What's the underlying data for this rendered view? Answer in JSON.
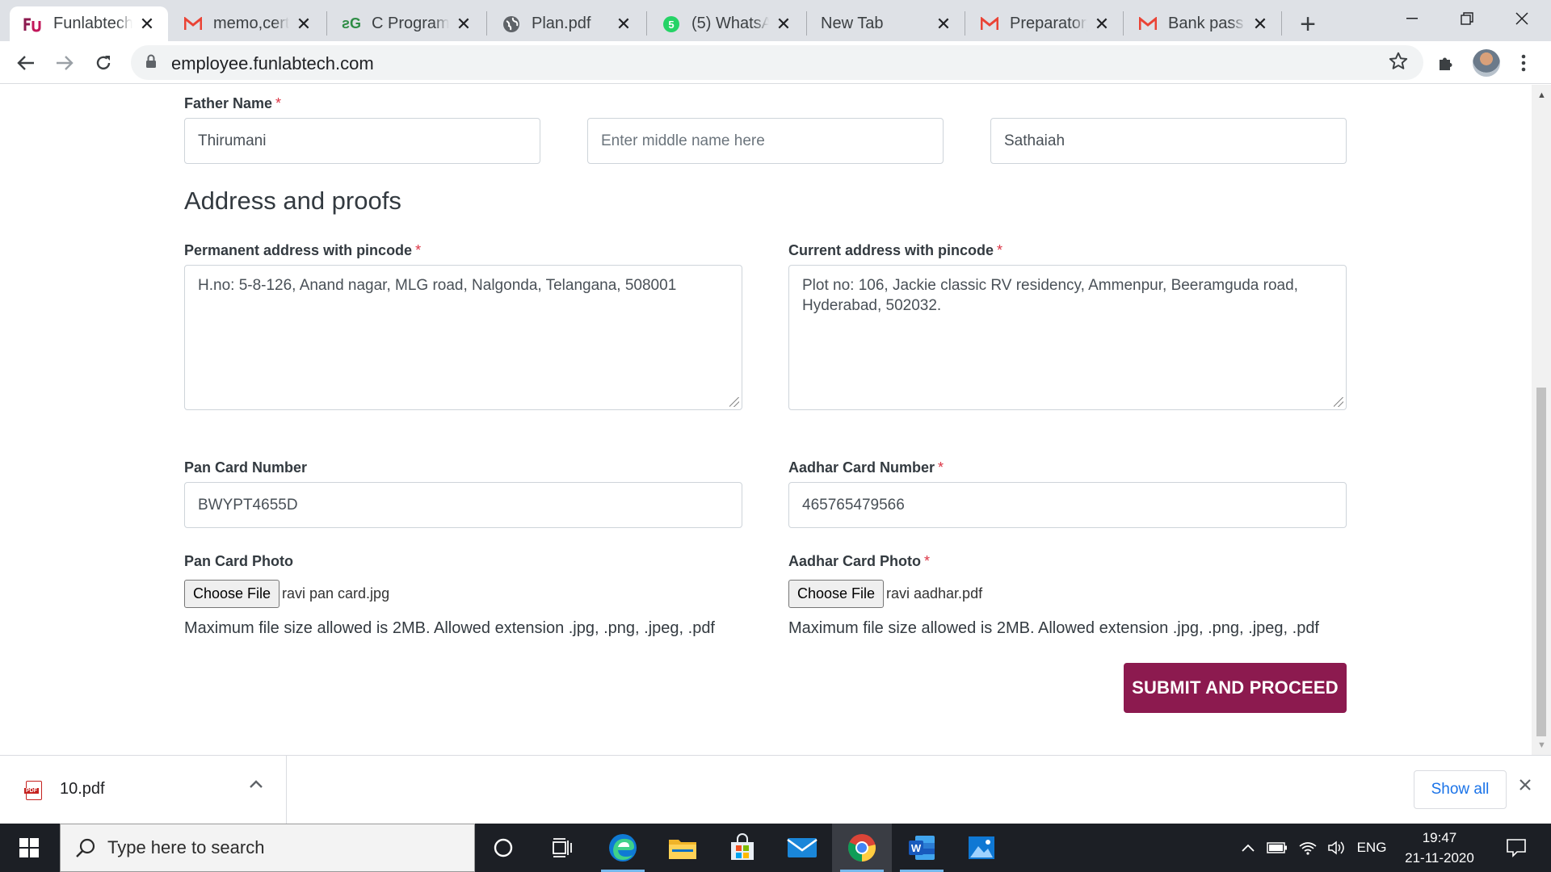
{
  "browser": {
    "tabs": [
      {
        "title": "Funlabtech - ",
        "favicon": "funlabtech-icon",
        "active": true
      },
      {
        "title": "memo,certi",
        "favicon": "gmail-icon",
        "active": false
      },
      {
        "title": "C Programm",
        "favicon": "geeksforgeeks-icon",
        "active": false
      },
      {
        "title": "Plan.pdf",
        "favicon": "globe-icon",
        "active": false
      },
      {
        "title": "(5) WhatsAp",
        "favicon": "whatsapp-icon",
        "active": false
      },
      {
        "title": "New Tab",
        "favicon": "",
        "active": false
      },
      {
        "title": "Preparatory",
        "favicon": "gmail-icon",
        "active": false
      },
      {
        "title": "Bank pass bo",
        "favicon": "gmail-icon",
        "active": false
      }
    ],
    "url": "employee.funlabtech.com"
  },
  "form": {
    "father_name": {
      "label": "Father Name",
      "required_mark": "*",
      "first": "Thirumani",
      "middle_placeholder": "Enter middle name here",
      "last": "Sathaiah"
    },
    "section_title": "Address and proofs",
    "permanent_address": {
      "label": "Permanent address with pincode",
      "required_mark": "*",
      "value": "H.no: 5-8-126, Anand nagar, MLG road, Nalgonda, Telangana, 508001"
    },
    "current_address": {
      "label": "Current address with pincode",
      "required_mark": "*",
      "value": "Plot no: 106, Jackie classic RV residency, Ammenpur, Beeramguda road, Hyderabad, 502032."
    },
    "pan_number": {
      "label": "Pan Card Number",
      "value": "BWYPT4655D"
    },
    "aadhar_number": {
      "label": "Aadhar Card Number",
      "required_mark": "*",
      "value": "465765479566"
    },
    "pan_photo": {
      "label": "Pan Card Photo",
      "button": "Choose File",
      "filename": "ravi pan card.jpg",
      "hint": "Maximum file size allowed is 2MB. Allowed extension .jpg, .png, .jpeg, .pdf"
    },
    "aadhar_photo": {
      "label": "Aadhar Card Photo",
      "required_mark": "*",
      "button": "Choose File",
      "filename": "ravi aadhar.pdf",
      "hint": "Maximum file size allowed is 2MB. Allowed extension .jpg, .png, .jpeg, .pdf"
    },
    "submit_label": "SUBMIT AND PROCEED",
    "accent_color": "#8c1a4f"
  },
  "downloads": {
    "file": "10.pdf",
    "file_icon_label": "PDF",
    "show_all": "Show all"
  },
  "taskbar": {
    "search_placeholder": "Type here to search",
    "language": "ENG",
    "time": "19:47",
    "date": "21-11-2020"
  }
}
